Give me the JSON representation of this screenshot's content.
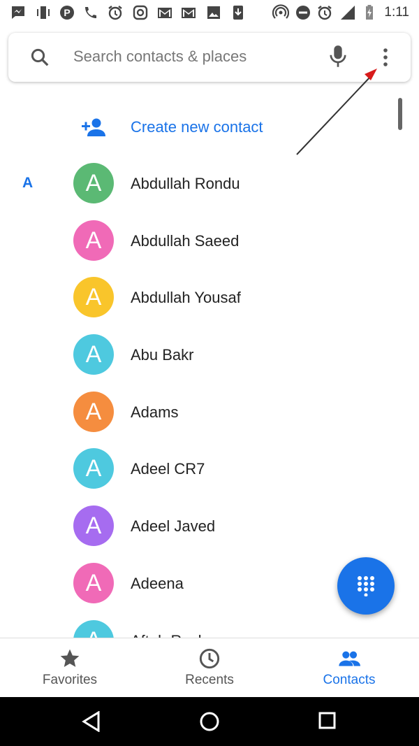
{
  "status_bar": {
    "time": "1:11",
    "left_icons": [
      "messenger-icon",
      "vibrate-icon",
      "pinterest-icon",
      "missed-call-icon",
      "alarm-icon",
      "instagram-icon",
      "gmail-icon",
      "gmail-icon",
      "image-icon",
      "download-icon"
    ],
    "right_icons": [
      "hotspot-icon",
      "dnd-icon",
      "alarm-icon",
      "lte-signal-icon",
      "battery-charging-icon"
    ]
  },
  "search": {
    "placeholder": "Search contacts & places"
  },
  "create_contact": {
    "label": "Create new contact"
  },
  "contacts": {
    "section_letter": "A",
    "items": [
      {
        "initial": "A",
        "name": "Abdullah Rondu",
        "color": "#5bb974"
      },
      {
        "initial": "A",
        "name": "Abdullah Saeed",
        "color": "#f06ab7"
      },
      {
        "initial": "A",
        "name": "Abdullah Yousaf",
        "color": "#f9c52b"
      },
      {
        "initial": "A",
        "name": "Abu Bakr",
        "color": "#4ec9df"
      },
      {
        "initial": "A",
        "name": "Adams",
        "color": "#f58d3f"
      },
      {
        "initial": "A",
        "name": "Adeel CR7",
        "color": "#4ec9df"
      },
      {
        "initial": "A",
        "name": "Adeel Javed",
        "color": "#a66cf0"
      },
      {
        "initial": "A",
        "name": "Adeena",
        "color": "#f06ab7"
      },
      {
        "initial": "A",
        "name": "Aftab Roshan",
        "color": "#4ec9df"
      }
    ]
  },
  "bottom_nav": {
    "tabs": [
      {
        "label": "Favorites",
        "icon": "star-icon",
        "active": false
      },
      {
        "label": "Recents",
        "icon": "clock-icon",
        "active": false
      },
      {
        "label": "Contacts",
        "icon": "people-icon",
        "active": true
      }
    ]
  },
  "colors": {
    "accent": "#1a73e8",
    "annotation_arrow": "#d81b1b"
  }
}
